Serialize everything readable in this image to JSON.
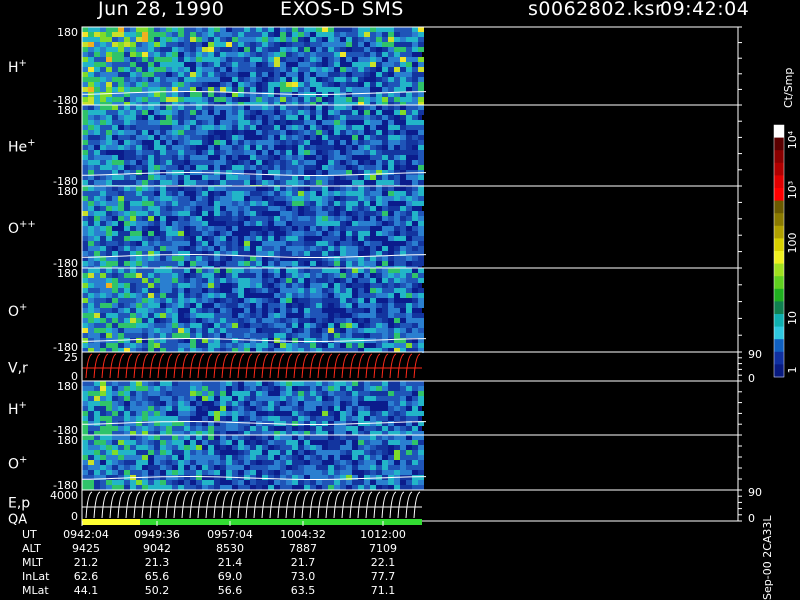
{
  "header": {
    "date": "Jun 28, 1990",
    "instrument": "EXOS-D SMS",
    "file": "s0062802.ksr",
    "time": "09:42:04"
  },
  "colorbar": {
    "label": "Ct/Smp",
    "ticks": [
      "1",
      "10",
      "100",
      "10³",
      "10⁴"
    ]
  },
  "side_note": "Sep-00 2CA33L",
  "chart_data": {
    "type": "heatmap",
    "x_range_ut": [
      "09:42:04",
      "10:19:28"
    ],
    "data_end_ut": "10:12:30",
    "panels": [
      {
        "label_main": "H",
        "label_sup": "+",
        "ylim": [
          -180,
          180
        ],
        "yticks": [
          "180",
          "-180"
        ],
        "kind": "spectrogram",
        "intensity": 0.85
      },
      {
        "label_main": "He",
        "label_sup": "+",
        "ylim": [
          -180,
          180
        ],
        "yticks": [
          "180",
          "-180"
        ],
        "kind": "spectrogram",
        "intensity": 0.35
      },
      {
        "label_main": "O",
        "label_sup": "++",
        "ylim": [
          -180,
          180
        ],
        "yticks": [
          "180",
          "-180"
        ],
        "kind": "spectrogram",
        "intensity": 0.4
      },
      {
        "label_main": "O",
        "label_sup": "+",
        "ylim": [
          -180,
          180
        ],
        "yticks": [
          "180",
          "-180"
        ],
        "kind": "spectrogram",
        "intensity": 0.6
      },
      {
        "label_main": "V,r",
        "label_sup": "",
        "ylim": [
          0,
          25
        ],
        "yticks": [
          "25",
          "0"
        ],
        "right_ticks": [
          "90",
          "0"
        ],
        "kind": "line",
        "line_color": "#ff2a1a"
      },
      {
        "label_main": "H",
        "label_sup": "+",
        "ylim": [
          -180,
          180
        ],
        "yticks": [
          "180",
          "-180"
        ],
        "kind": "spectrogram",
        "intensity": 0.55
      },
      {
        "label_main": "O",
        "label_sup": "+",
        "ylim": [
          -180,
          180
        ],
        "yticks": [
          "180",
          "-180"
        ],
        "kind": "spectrogram",
        "intensity": 0.45
      },
      {
        "label_main": "E,p",
        "label_sup": "",
        "label2": "QA",
        "ylim": [
          0,
          4000
        ],
        "yticks": [
          "4000",
          "0"
        ],
        "right_ticks": [
          "90",
          "0"
        ],
        "kind": "line",
        "line_color": "#ffffff"
      }
    ],
    "qa_bar": [
      {
        "from": "09:42:04",
        "to": "09:49:36",
        "color": "#ffff33"
      },
      {
        "from": "09:49:36",
        "to": "10:12:00",
        "color": "#33dd33"
      }
    ],
    "orbit_table": {
      "row_labels": [
        "UT",
        "ALT",
        "MLT",
        "InLat",
        "MLat"
      ],
      "columns": [
        {
          "UT": "0942:04",
          "ALT": "9425",
          "MLT": "21.2",
          "InLat": "62.6",
          "MLat": "44.1"
        },
        {
          "UT": "0949:36",
          "ALT": "9042",
          "MLT": "21.3",
          "InLat": "65.6",
          "MLat": "50.2"
        },
        {
          "UT": "0957:04",
          "ALT": "8530",
          "MLT": "21.4",
          "InLat": "69.0",
          "MLat": "56.6"
        },
        {
          "UT": "1004:32",
          "ALT": "7887",
          "MLT": "21.7",
          "InLat": "73.0",
          "MLat": "63.5"
        },
        {
          "UT": "1012:00",
          "ALT": "7109",
          "MLT": "22.1",
          "InLat": "77.7",
          "MLat": "71.1"
        }
      ]
    }
  }
}
